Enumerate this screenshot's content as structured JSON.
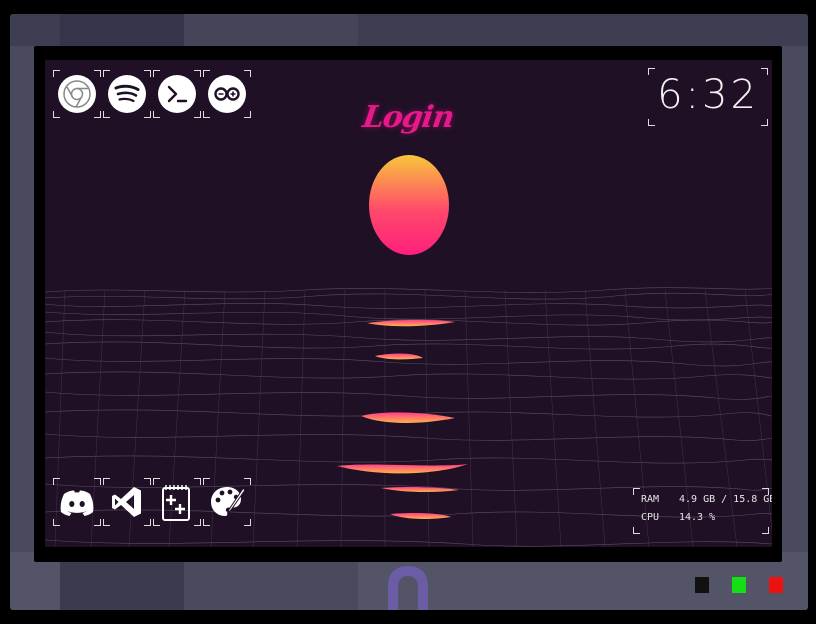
{
  "screen": {
    "title": "Login",
    "clock": "6:32"
  },
  "top_icons": [
    {
      "name": "chrome-icon"
    },
    {
      "name": "spotify-icon"
    },
    {
      "name": "terminal-icon"
    },
    {
      "name": "arduino-icon"
    }
  ],
  "bottom_icons": [
    {
      "name": "discord-icon"
    },
    {
      "name": "visual-studio-icon"
    },
    {
      "name": "notepad-plus-plus-icon"
    },
    {
      "name": "paint-palette-icon"
    }
  ],
  "system_stats": {
    "ram_label": "RAM",
    "ram_value": "4.9 GB / 15.8 GB",
    "cpu_label": "CPU",
    "cpu_value": "14.3 %"
  },
  "monitor_buttons": [
    {
      "name": "black-button",
      "color": "#111111"
    },
    {
      "name": "green-button",
      "color": "#12e012"
    },
    {
      "name": "red-button",
      "color": "#ee1111"
    }
  ],
  "colors": {
    "accent": "#e8188a",
    "sun_top": "#f8c53a",
    "sun_bottom": "#ff2d7a",
    "screen_bg": "#1f1026",
    "frame": "#4a4a5e",
    "magnet": "#6b5ca5"
  }
}
